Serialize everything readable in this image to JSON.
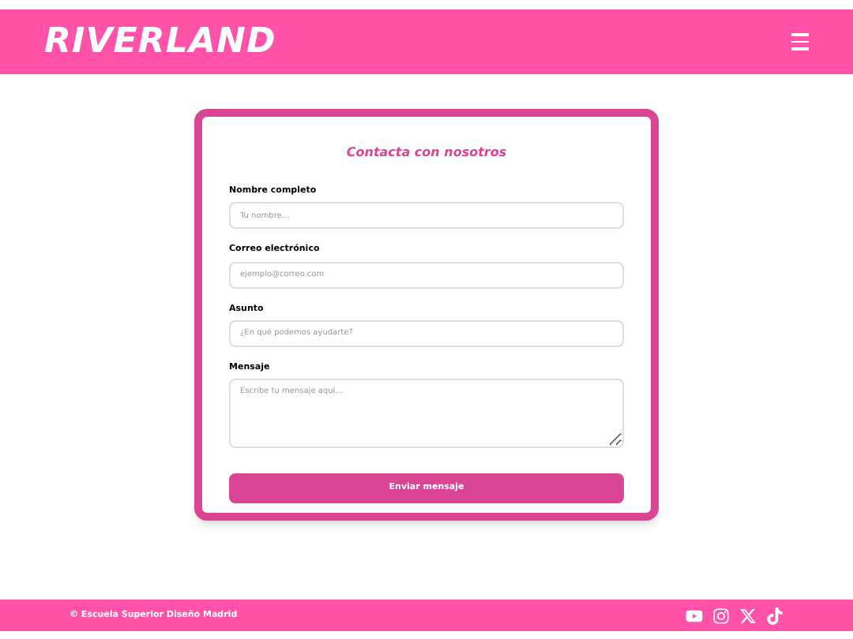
{
  "header": {
    "logo": "RIVERLAND"
  },
  "form": {
    "title": "Contacta con nosotros",
    "fields": [
      {
        "kind": "input",
        "label": "Nombre completo",
        "placeholder": "Tu nombre..."
      },
      {
        "kind": "input",
        "label": "Correo electrónico",
        "placeholder": "ejemplo@correo.com"
      },
      {
        "kind": "input",
        "label": "Asunto",
        "placeholder": "¿En qué podemos ayudarte?"
      },
      {
        "kind": "textarea",
        "label": "Mensaje",
        "placeholder": "Escribe tu mensaje aquí..."
      }
    ],
    "submit": "Enviar mensaje"
  },
  "footer": {
    "copyright": "© Escuela Superior Diseño Madrid"
  }
}
